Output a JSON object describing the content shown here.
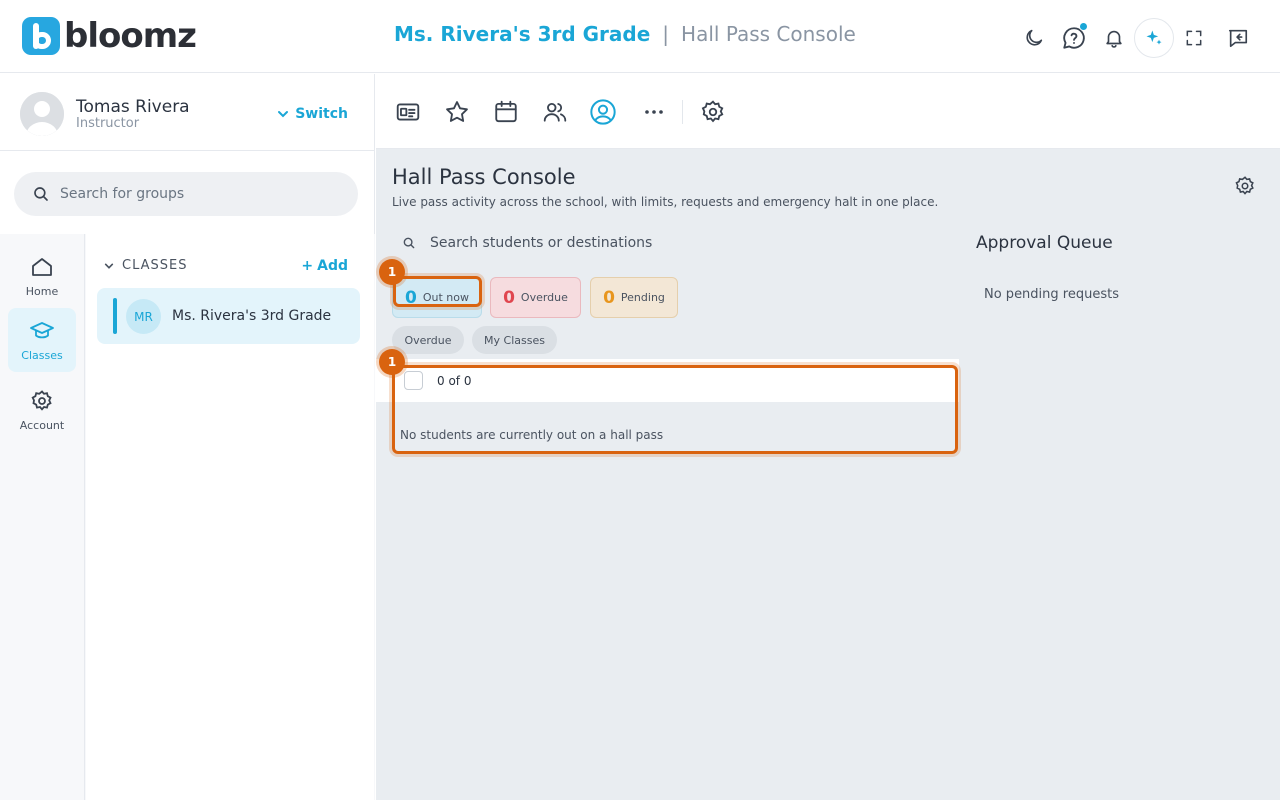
{
  "brand": {
    "name": "bloomz"
  },
  "header": {
    "class_name": "Ms. Rivera's 3rd Grade",
    "separator": "|",
    "page_name": "Hall Pass Console",
    "icons": [
      "moon-icon",
      "help-icon",
      "bell-icon",
      "sparkle-icon",
      "fullscreen-icon",
      "message-icon"
    ]
  },
  "user": {
    "name": "Tomas Rivera",
    "role": "Instructor",
    "switch_label": "Switch"
  },
  "sidebar": {
    "search_placeholder": "Search for groups",
    "nav": [
      {
        "label": "Home",
        "icon": "home-icon",
        "active": false
      },
      {
        "label": "Classes",
        "icon": "graduation-cap-icon",
        "active": true
      },
      {
        "label": "Account",
        "icon": "gear-icon",
        "active": false
      }
    ],
    "classes_heading": "CLASSES",
    "add_label": "Add",
    "classes": [
      {
        "initials": "MR",
        "name": "Ms. Rivera's 3rd Grade"
      }
    ]
  },
  "toolbar": {
    "icons": [
      "id-card-icon",
      "star-icon",
      "calendar-icon",
      "people-icon",
      "profile-icon",
      "more-icon",
      "settings-icon"
    ],
    "active": "profile-icon"
  },
  "console": {
    "title": "Hall Pass Console",
    "subtitle": "Live pass activity across the school, with limits, requests and emergency halt in one place.",
    "search_placeholder": "Search students or destinations",
    "stats": [
      {
        "value": "0",
        "label": "Out now",
        "color": "#1aa6d6"
      },
      {
        "value": "0",
        "label": "Overdue",
        "color": "#e0464f"
      },
      {
        "value": "0",
        "label": "Pending",
        "color": "#e8961e"
      }
    ],
    "filters": [
      "Overdue",
      "My Classes"
    ],
    "count_text": "0 of 0",
    "empty_text": "No students are currently out on a hall pass"
  },
  "approval": {
    "title": "Approval Queue",
    "empty_text": "No pending requests"
  },
  "annotations": [
    {
      "label": "1"
    },
    {
      "label": "1"
    }
  ],
  "colors": {
    "accent": "#1aa6d6",
    "annotation": "#d9630f"
  }
}
